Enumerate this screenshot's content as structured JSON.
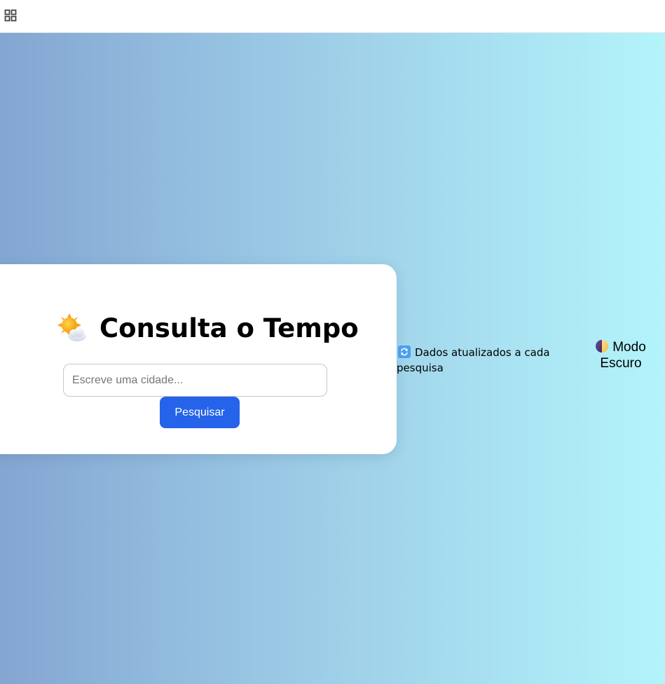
{
  "app": {
    "grid_icon": "apps-grid-icon"
  },
  "card": {
    "title_icon": "sun-behind-cloud-icon",
    "title": "Consulta o Tempo",
    "search": {
      "placeholder": "Escreve uma cidade...",
      "value": ""
    },
    "search_button_label": "Pesquisar"
  },
  "info": {
    "icon": "refresh-icon",
    "text": "Dados atualizados a cada pesquisa"
  },
  "theme_toggle": {
    "icon": "half-moon-icon",
    "label": "Modo Escuro"
  },
  "colors": {
    "accent": "#2563eb",
    "gradient_start": "#84a6d2",
    "gradient_end": "#b3f4fb"
  }
}
